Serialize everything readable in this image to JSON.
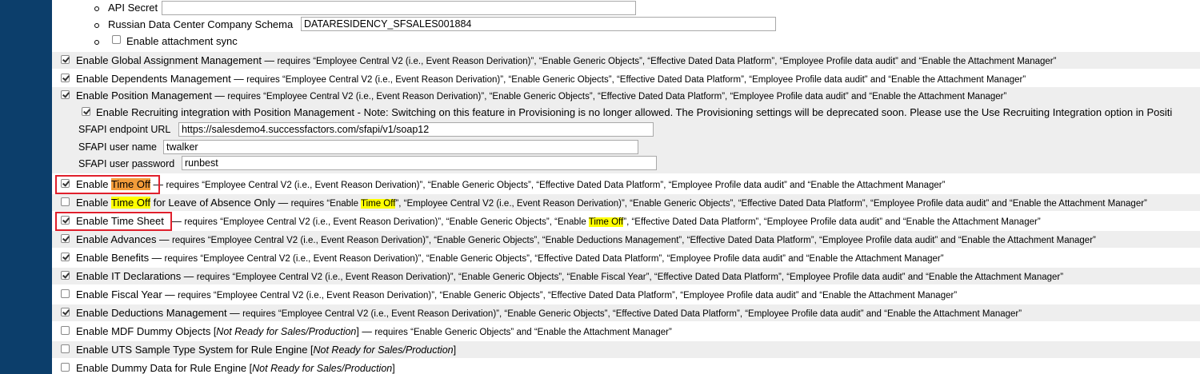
{
  "subsettings": {
    "api_secret": {
      "label": "API Secret",
      "value": ""
    },
    "russian_schema": {
      "label": "Russian Data Center Company Schema",
      "value": "DATARESIDENCY_SFSALES001884"
    },
    "attachment_sync": {
      "label": "Enable attachment sync",
      "checked": false
    }
  },
  "common": {
    "em": "—",
    "requires": "requires",
    "sep": ", ",
    "and": "and",
    "ec": "“Employee Central V2 (i.e., Event Reason Derivation)”",
    "go": "“Enable Generic Objects”",
    "edp": "“Effective Dated Data Platform”",
    "epa": "“Employee Profile data audit”",
    "am": "“Enable the Attachment Manager”",
    "dm": "“Enable Deductions Management”",
    "fy": "“Enable Fiscal Year”",
    "enable_open": "“Enable ",
    "close_q": "”",
    "not_ready": "Not Ready for Sales/Production",
    "bracket_open": "[",
    "bracket_close": "]"
  },
  "features": {
    "global_assignment": {
      "label": "Enable Global Assignment Management",
      "checked": true
    },
    "dependents": {
      "label": "Enable Dependents Management",
      "checked": true
    },
    "position": {
      "label": "Enable Position Management",
      "checked": true
    },
    "recruiting": {
      "checked": true,
      "label": "Enable Recruiting integration with Position Management - Note: Switching on this feature in Provisioning is no longer allowed. The Provisioning settings will be deprecated soon. Please use the Use Recruiting Integration option in Positi"
    },
    "sfapi_url": {
      "label": "SFAPI endpoint URL",
      "value": "https://salesdemo4.successfactors.com/sfapi/v1/soap12"
    },
    "sfapi_user": {
      "label": "SFAPI user name",
      "value": "twalker"
    },
    "sfapi_pass": {
      "label": "SFAPI user password",
      "value": "runbest"
    },
    "time_off": {
      "label_prefix": "Enable ",
      "label_hl": "Time Off",
      "checked": true
    },
    "time_off_loa": {
      "label_prefix": "Enable ",
      "label_hl": "Time Off",
      "label_suffix": " for Leave of Absence Only",
      "checked": false
    },
    "time_off_hl": "Time Off",
    "time_sheet": {
      "label": "Enable Time Sheet",
      "checked": true
    },
    "advances": {
      "label": "Enable Advances",
      "checked": true
    },
    "benefits": {
      "label": "Enable Benefits",
      "checked": true
    },
    "it_declarations": {
      "label": "Enable IT Declarations",
      "checked": true
    },
    "fiscal_year": {
      "label": "Enable Fiscal Year",
      "checked": false
    },
    "deductions": {
      "label": "Enable Deductions Management",
      "checked": true
    },
    "mdf_dummy": {
      "label": "Enable MDF Dummy Objects",
      "checked": false
    },
    "uts_sample": {
      "label": "Enable UTS Sample Type System for Rule Engine",
      "checked": false
    },
    "dummy_data": {
      "label": "Enable Dummy Data for Rule Engine",
      "checked": false
    }
  }
}
